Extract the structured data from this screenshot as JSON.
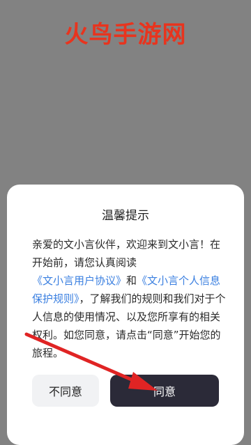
{
  "watermark": {
    "text": "火鸟手游网"
  },
  "dialog": {
    "title": "温馨提示",
    "body": {
      "intro": "亲爱的文小言伙伴，欢迎来到文小言！在开始前，请您认真阅读",
      "link_user_agreement": "《文小言用户协议》",
      "and": "和",
      "link_privacy_policy": "《文小言个人信息保护规则》",
      "rest": "，了解我们的规则和我们对于个人信息的使用情况、以及您所享有的相关权利。如您同意，请点击“同意”开始您的旅程。"
    },
    "buttons": {
      "decline": "不同意",
      "accept": "同意"
    }
  },
  "colors": {
    "backdrop": "#828282",
    "watermark": "#e8341e",
    "link": "#3a7fe0",
    "accept_button": "#2b2a38",
    "decline_button": "#f1f2f4",
    "annotation_arrow": "#e02424"
  }
}
